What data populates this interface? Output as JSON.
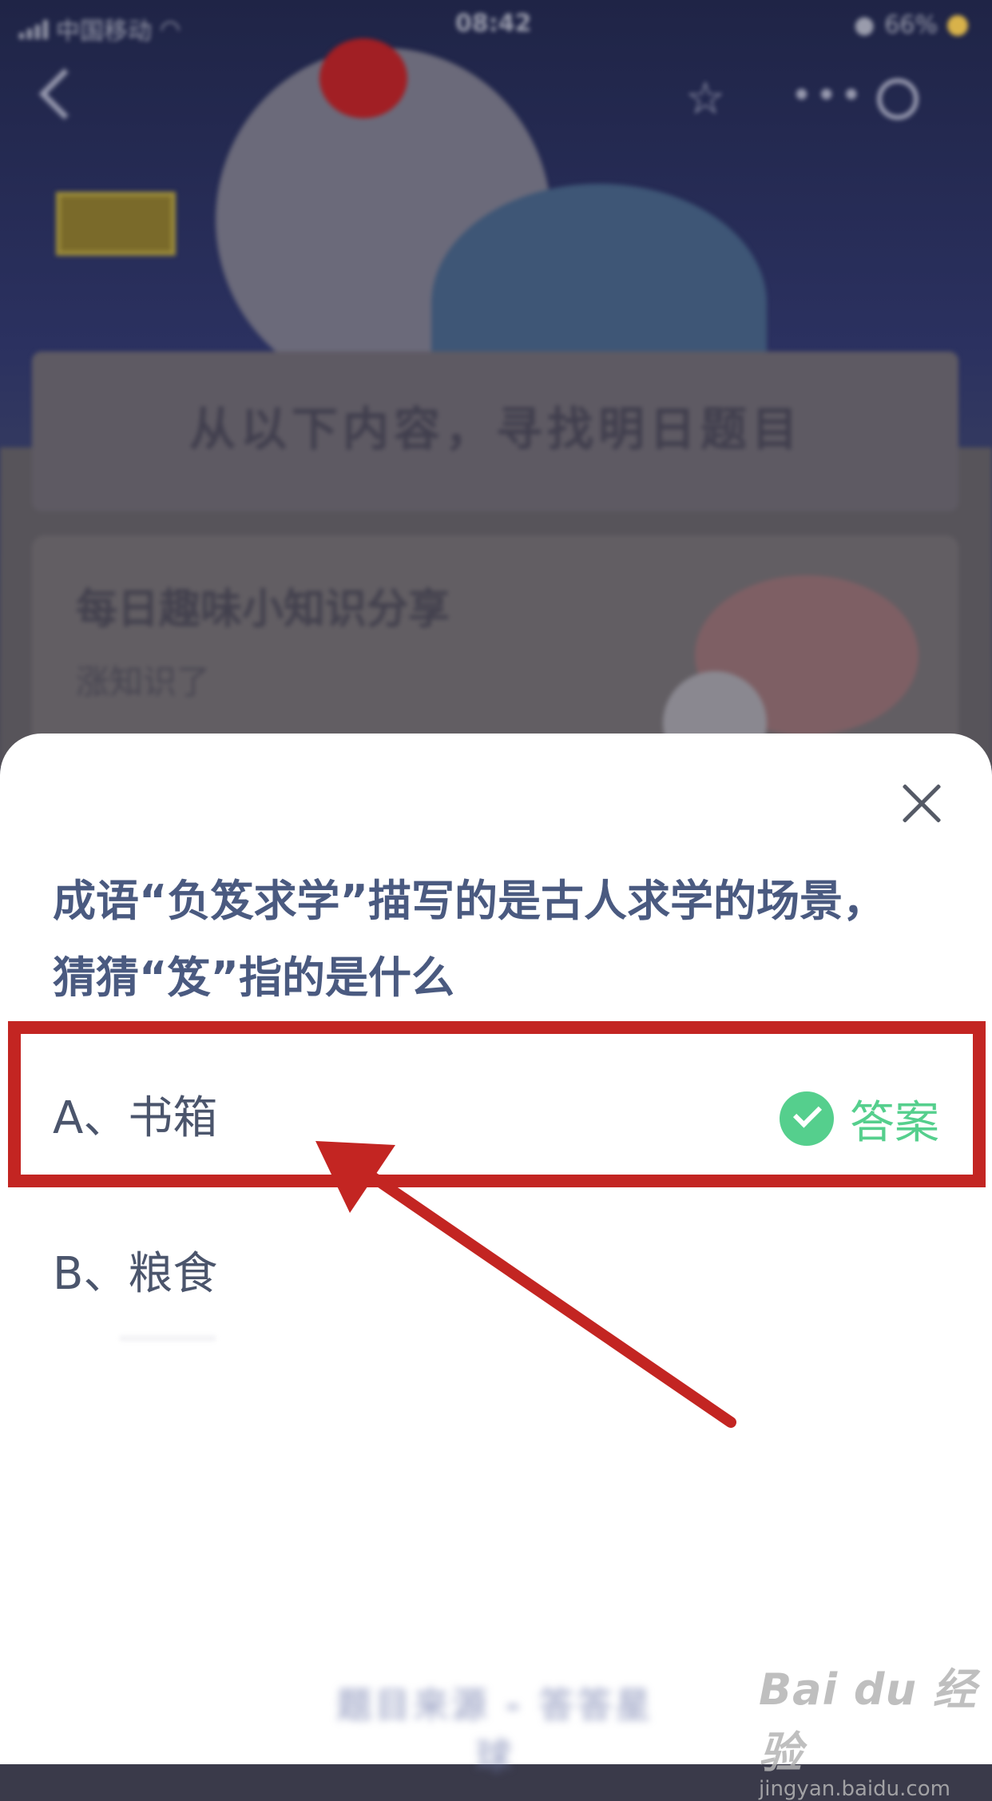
{
  "status_bar": {
    "carrier": "中国移动",
    "time": "08:42",
    "battery": "66%"
  },
  "background": {
    "card_title": "从以下内容，寻找明日题目",
    "info_title": "每日趣味小知识分享",
    "info_subtitle": "涨知识了"
  },
  "quiz": {
    "question": "成语“负笈求学”描写的是古人求学的场景，猜猜“笈”指的是什么",
    "options": [
      {
        "letter": "A",
        "text": "、书箱",
        "is_answer": true
      },
      {
        "letter": "B",
        "text": "、粮食",
        "is_answer": false
      }
    ],
    "answer_label": "答案",
    "answer_color": "#55cf8d",
    "bottom_link": "题目来源 - 答答星球"
  },
  "annotation": {
    "highlight_color": "#c32522"
  },
  "watermark": {
    "brand": "Bai du 经验",
    "url": "jingyan.baidu.com"
  }
}
